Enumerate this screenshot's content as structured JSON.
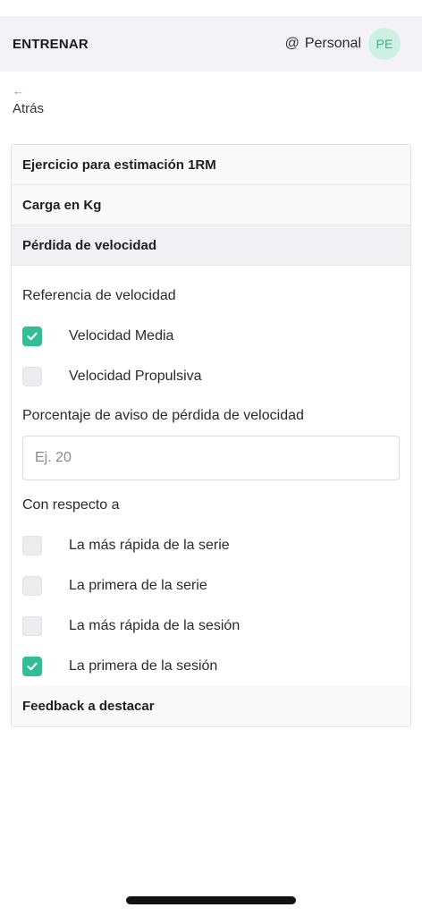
{
  "header": {
    "title": "ENTRENAR",
    "user_prefix_icon": "@",
    "user_label": "Personal",
    "avatar_initials": "PE"
  },
  "back": {
    "icon": "←",
    "label": "Atrás"
  },
  "sections": {
    "exercise": "Ejercicio para estimación 1RM",
    "load": "Carga en Kg",
    "velocity_loss": "Pérdida de velocidad",
    "feedback": "Feedback a destacar"
  },
  "velocity_loss": {
    "reference_label": "Referencia de velocidad",
    "reference_options": [
      {
        "label": "Velocidad Media",
        "checked": true
      },
      {
        "label": "Velocidad Propulsiva",
        "checked": false
      }
    ],
    "percentage_label": "Porcentaje de aviso de pérdida de velocidad",
    "percentage_input": {
      "value": "",
      "placeholder": "Ej. 20"
    },
    "respect_label": "Con respecto a",
    "respect_options": [
      {
        "label": "La más rápida de la serie",
        "checked": false
      },
      {
        "label": "La primera de la serie",
        "checked": false
      },
      {
        "label": "La más rápida de la sesión",
        "checked": false
      },
      {
        "label": "La primera de la sesión",
        "checked": true
      }
    ]
  },
  "colors": {
    "accent": "#2fbf93",
    "topbar_bg": "#f3f2f7",
    "avatar_bg": "#cdf0e3"
  }
}
